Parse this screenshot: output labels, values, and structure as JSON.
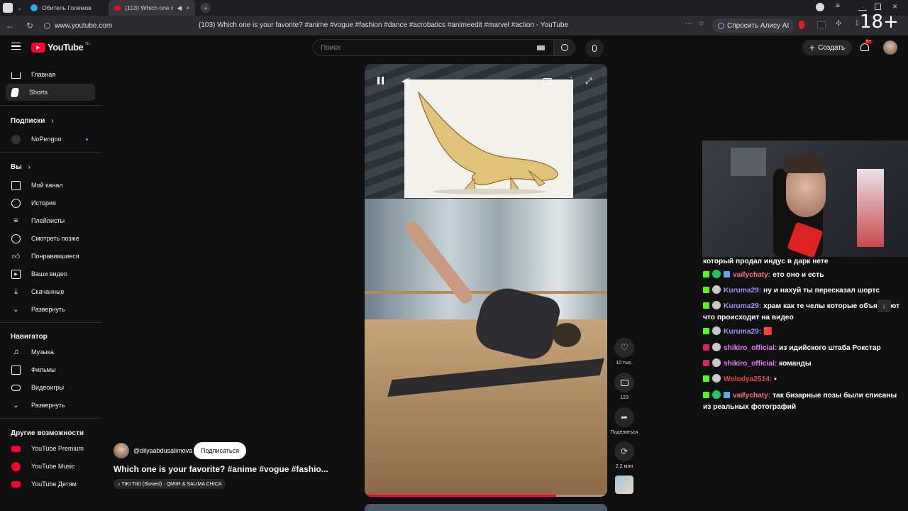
{
  "browser": {
    "tabs": [
      {
        "label": "Обитель Големов",
        "active": false
      },
      {
        "label": "(103) Which one is y",
        "active": true
      }
    ],
    "url": "www.youtube.com",
    "page_title": "(103) Which one is your favorite? #anime #vogue #fashion #dance #acrobatics #animeedit #marvel #action - YouTube",
    "alice_label": "Спросить Алису AI",
    "overlay_label": "18+"
  },
  "masthead": {
    "logo_text": "YouTube",
    "region": "NL",
    "search_placeholder": "Поиск",
    "create_label": "Создать",
    "notif_count": "9+"
  },
  "sidebar": {
    "main": [
      {
        "label": "Главная",
        "icon": "home-icon"
      },
      {
        "label": "Shorts",
        "icon": "shorts-icon",
        "active": true
      }
    ],
    "subs_heading": "Подписки",
    "subs": [
      {
        "label": "NoPengoo"
      }
    ],
    "you_heading": "Вы",
    "you": [
      {
        "label": "Мой канал",
        "icon": "channel-icon"
      },
      {
        "label": "История",
        "icon": "history-icon"
      },
      {
        "label": "Плейлисты",
        "icon": "playlist-icon"
      },
      {
        "label": "Смотреть позже",
        "icon": "clock-icon"
      },
      {
        "label": "Понравившиеся",
        "icon": "like-icon"
      },
      {
        "label": "Ваши видео",
        "icon": "video-icon"
      },
      {
        "label": "Скачанные",
        "icon": "download-icon"
      },
      {
        "label": "Развернуть",
        "icon": "chevron-down-icon"
      }
    ],
    "nav_heading": "Навигатор",
    "nav": [
      {
        "label": "Музыка",
        "icon": "music-icon"
      },
      {
        "label": "Фильмы",
        "icon": "film-icon"
      },
      {
        "label": "Видеоигры",
        "icon": "gaming-icon"
      },
      {
        "label": "Развернуть",
        "icon": "chevron-down-icon"
      }
    ],
    "more_heading": "Другие возможности",
    "more": [
      {
        "label": "YouTube Premium"
      },
      {
        "label": "YouTube Music"
      },
      {
        "label": "YouTube Детям"
      }
    ]
  },
  "short": {
    "channel": "@dilyaabdusalimova",
    "subscribe_label": "Подписаться",
    "title": "Which one is your favorite? #anime #vogue #fashio...",
    "sound": "♪ TIKI TIKI (Slowed) · QMIIR & SALIMA CHICA",
    "likes": "10 тыс.",
    "comments": "123",
    "share_label": "Поделиться",
    "remix": "2,2 млн",
    "progress": 0.79
  },
  "chat": [
    {
      "badges": [],
      "nick": "",
      "nick_color": "#ffffff",
      "text": "который продал индус в дарк нете"
    },
    {
      "badges": [
        "kick",
        "heart",
        "sword"
      ],
      "nick": "vaifychaty:",
      "nick_color": "#ff6b81",
      "text": "ето оно и есть"
    },
    {
      "badges": [
        "kick",
        "avatar"
      ],
      "nick": "Kuruma29:",
      "nick_color": "#a78bfa",
      "text": "ну и нахуй ты пересказал шортс"
    },
    {
      "badges": [
        "kick",
        "avatar"
      ],
      "nick": "Kuruma29:",
      "nick_color": "#a78bfa",
      "text": "храм как те челы которые объясняют что происходит на видео"
    },
    {
      "badges": [
        "kick",
        "avatar"
      ],
      "nick": "Kuruma29:",
      "nick_color": "#a78bfa",
      "text": "🟥"
    },
    {
      "badges": [
        "live",
        "avatar"
      ],
      "nick": "shikiro_official:",
      "nick_color": "#e879f9",
      "text": "из идийского штаба Рокстар"
    },
    {
      "badges": [
        "live",
        "avatar"
      ],
      "nick": "shikiro_official:",
      "nick_color": "#e879f9",
      "text": "команды"
    },
    {
      "badges": [
        "kick",
        "avatar"
      ],
      "nick": "Wolodya2514:",
      "nick_color": "#ef4444",
      "text": "▪"
    },
    {
      "badges": [
        "kick",
        "heart",
        "sword"
      ],
      "nick": "vaifychaty:",
      "nick_color": "#ff6b81",
      "text": "так бизарные позы были списаны из реальных фотографий"
    }
  ]
}
